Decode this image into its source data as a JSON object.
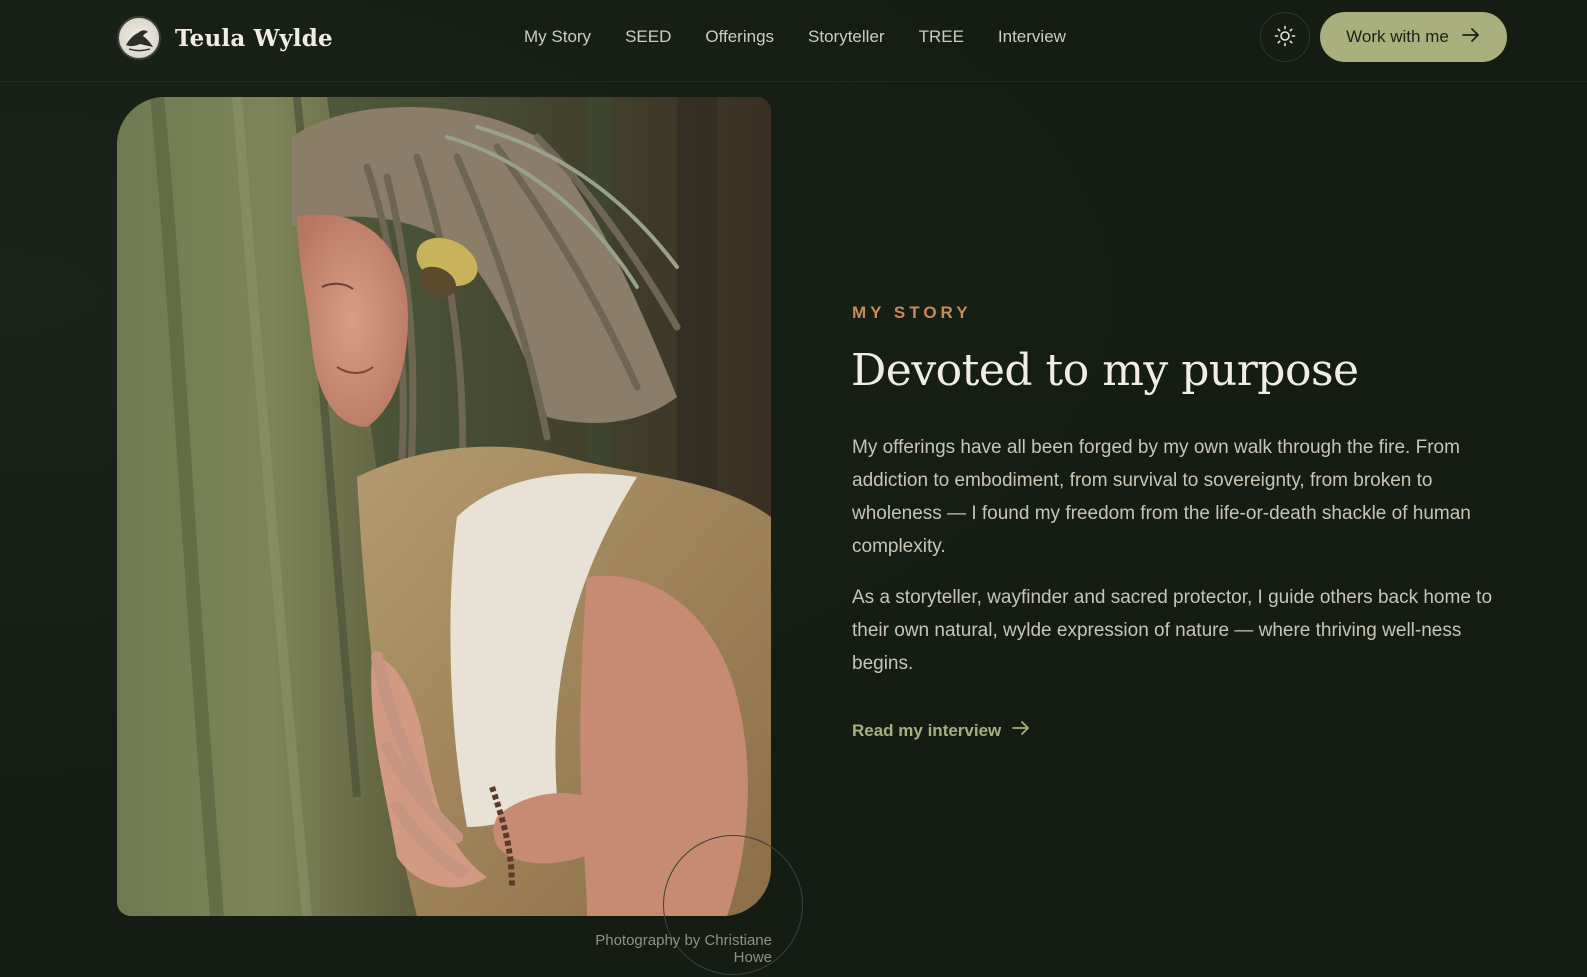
{
  "brand": {
    "name": "Teula Wylde"
  },
  "nav": {
    "items": [
      "My Story",
      "SEED",
      "Offerings",
      "Storyteller",
      "TREE",
      "Interview"
    ]
  },
  "header": {
    "cta_label": "Work with me"
  },
  "story": {
    "eyebrow": "MY STORY",
    "title": "Devoted to my purpose",
    "paragraphs": [
      "My offerings have all been forged by my own walk through the fire. From addiction to embodiment, from survival to sovereignty, from broken to wholeness — I found my freedom from the life-or-death shackle of human complexity.",
      "As a storyteller, wayfinder and sacred protector, I guide others back home to their own natural, wylde expression of nature — where thriving well-ness begins."
    ],
    "link_label": "Read my interview"
  },
  "photo": {
    "credit": "Photography by Christiane Howe"
  },
  "colors": {
    "background": "#141c14",
    "accent": "#a9b07e",
    "eyebrow": "#c88a57",
    "heading": "#f1ede2",
    "body_text": "#c9c4b4"
  },
  "icons": {
    "theme_toggle": "sun-icon",
    "cta_arrow": "arrow-right-icon",
    "link_arrow": "arrow-right-icon",
    "logo": "crow-logo-icon"
  }
}
